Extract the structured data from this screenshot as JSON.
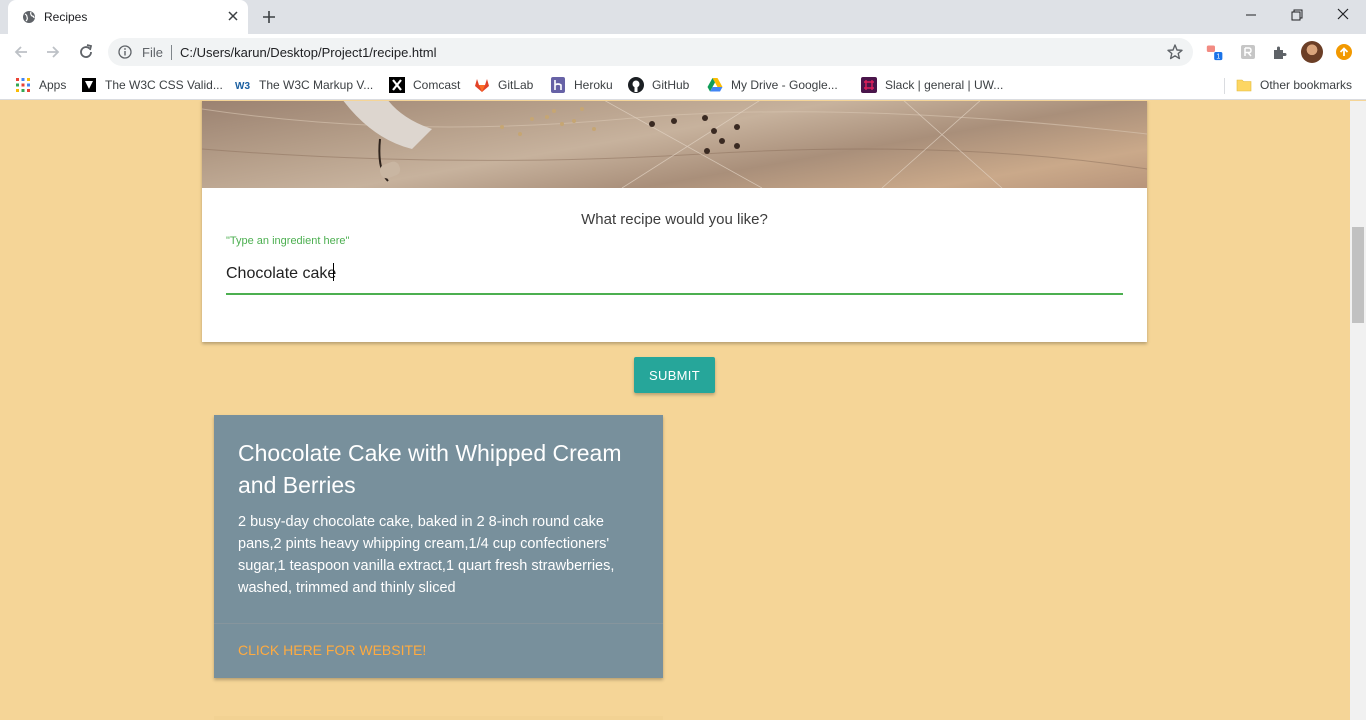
{
  "browser": {
    "tab": {
      "title": "Recipes"
    },
    "address": {
      "scheme_label": "File",
      "url": "C:/Users/karun/Desktop/Project1/recipe.html"
    },
    "extension_badge": "1",
    "bookmarks": [
      {
        "label": "Apps",
        "icon": "apps-grid-icon"
      },
      {
        "label": "The W3C CSS Valid...",
        "icon": "w3c-css-icon"
      },
      {
        "label": "The W3C Markup V...",
        "icon": "w3c-markup-icon"
      },
      {
        "label": "Comcast",
        "icon": "comcast-icon"
      },
      {
        "label": "GitLab",
        "icon": "gitlab-icon"
      },
      {
        "label": "Heroku",
        "icon": "heroku-icon"
      },
      {
        "label": "GitHub",
        "icon": "github-icon"
      },
      {
        "label": "My Drive - Google...",
        "icon": "google-drive-icon"
      },
      {
        "label": "Slack | general | UW...",
        "icon": "slack-icon"
      }
    ],
    "other_bookmarks": "Other bookmarks"
  },
  "search": {
    "prompt": "What recipe would you like?",
    "label": "\"Type an ingredient here\"",
    "value": "Chocolate cake",
    "submit_label": "SUBMIT"
  },
  "recipe": {
    "title": "Chocolate Cake with Whipped Cream and Berries",
    "ingredients": "2 busy-day chocolate cake, baked in 2 8-inch round cake pans,2 pints heavy whipping cream,1/4 cup confectioners' sugar,1 teaspoon vanilla extract,1 quart fresh strawberries, washed, trimmed and thinly sliced",
    "link_label": "CLICK HERE FOR WEBSITE!"
  },
  "colors": {
    "page_background": "#f5d597",
    "accent_green": "#4caf50",
    "button_teal": "#26a69a",
    "card_blue_grey": "#78909c",
    "link_orange": "#ffab40"
  }
}
